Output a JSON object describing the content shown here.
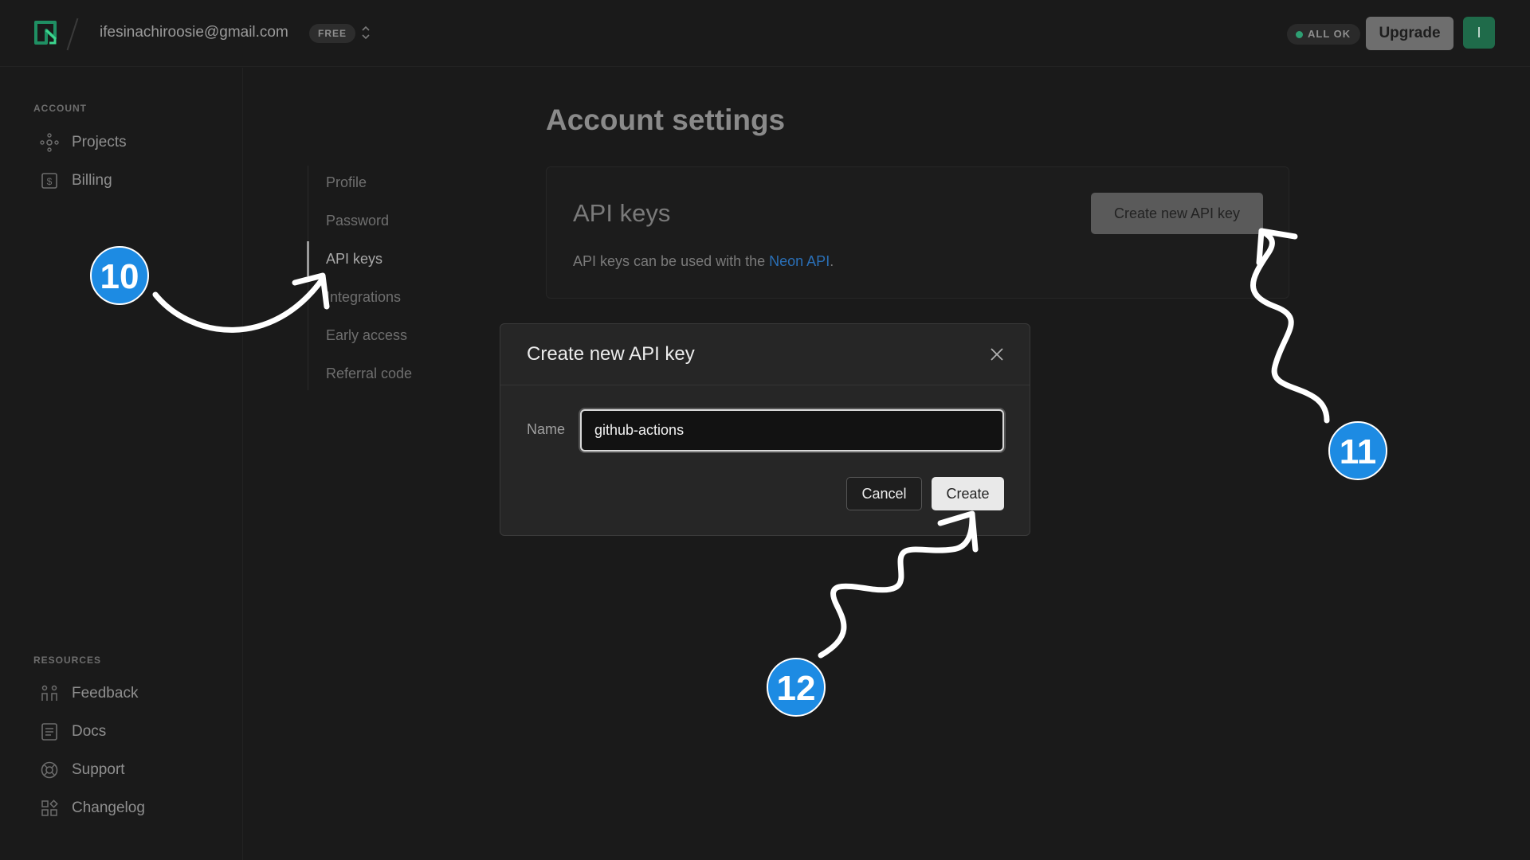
{
  "header": {
    "account_email": "ifesinachiroosie@gmail.com",
    "plan_badge": "FREE",
    "status_text": "ALL OK",
    "upgrade_label": "Upgrade",
    "avatar_initial": "I"
  },
  "sidebar": {
    "account_heading": "ACCOUNT",
    "account_items": [
      {
        "label": "Projects",
        "icon": "projects-icon"
      },
      {
        "label": "Billing",
        "icon": "billing-icon"
      }
    ],
    "resources_heading": "RESOURCES",
    "resource_items": [
      {
        "label": "Feedback",
        "icon": "feedback-icon"
      },
      {
        "label": "Docs",
        "icon": "docs-icon"
      },
      {
        "label": "Support",
        "icon": "support-icon"
      },
      {
        "label": "Changelog",
        "icon": "changelog-icon"
      }
    ]
  },
  "settings_nav": {
    "items": [
      "Profile",
      "Password",
      "API keys",
      "Integrations",
      "Early access",
      "Referral code"
    ],
    "active": "API keys"
  },
  "main": {
    "title": "Account settings",
    "card": {
      "title": "API keys",
      "description_prefix": "API keys can be used with the ",
      "description_link": "Neon API",
      "description_suffix": ".",
      "create_button": "Create new API key"
    }
  },
  "modal": {
    "title": "Create new API key",
    "name_label": "Name",
    "name_value": "github-actions",
    "cancel_label": "Cancel",
    "create_label": "Create"
  },
  "annotations": {
    "steps": [
      "10",
      "11",
      "12"
    ]
  },
  "colors": {
    "background": "#1a1a1a",
    "brand_green": "#2e9f73",
    "link_blue": "#2a6fb6",
    "step_badge": "#1d8be3"
  }
}
